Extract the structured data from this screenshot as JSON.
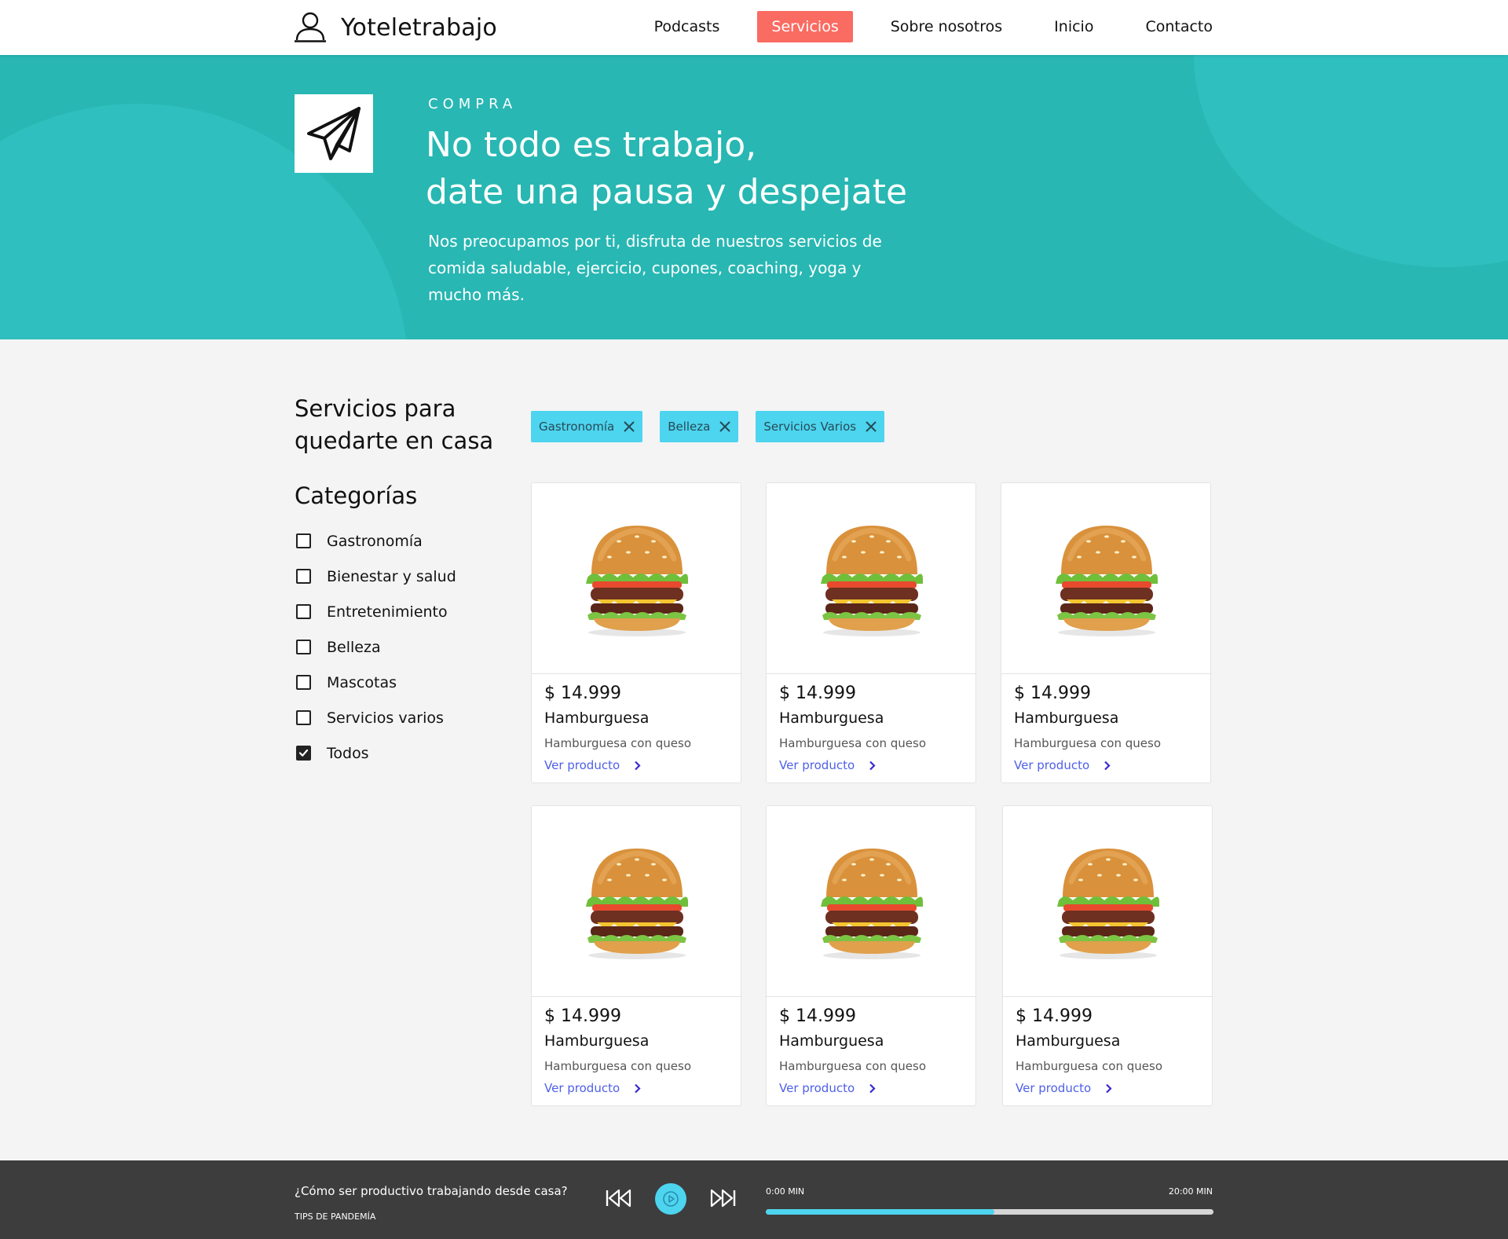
{
  "header": {
    "brand": "Yoteletrabajo",
    "brand_icon": "user-icon",
    "nav": [
      "Podcasts",
      "Servicios",
      "Sobre nosotros",
      "Inicio",
      "Contacto"
    ],
    "active_nav": "Servicios",
    "active_color": "#fa6b61"
  },
  "hero": {
    "icon": "paper-plane-icon",
    "eyebrow": "COMPRA",
    "title_line1": "No todo es trabajo,",
    "title_line2": "date una pausa y despejate",
    "description": "Nos preocupamos por ti, disfruta de nuestros servicios de comida saludable, ejercicio, cupones, coaching, yoga y mucho más.",
    "background_color": "#28b7b3"
  },
  "sidebar": {
    "title_line1": "Servicios para",
    "title_line2": "quedarte en casa",
    "categories_title": "Categorías",
    "categories": [
      {
        "label": "Gastronomía",
        "checked": false
      },
      {
        "label": "Bienestar y salud",
        "checked": false
      },
      {
        "label": "Entretenimiento",
        "checked": false
      },
      {
        "label": "Belleza",
        "checked": false
      },
      {
        "label": "Mascotas",
        "checked": false
      },
      {
        "label": "Servicios varios",
        "checked": false
      },
      {
        "label": "Todos",
        "checked": true
      }
    ]
  },
  "filters": {
    "chips": [
      "Gastronomía",
      "Belleza",
      "Servicios Varios"
    ],
    "chip_color": "#4dd4ef"
  },
  "products": [
    {
      "price": "$ 14.999",
      "name": "Hamburguesa",
      "description": "Hamburguesa con queso",
      "link": "Ver producto"
    },
    {
      "price": "$ 14.999",
      "name": "Hamburguesa",
      "description": "Hamburguesa con queso",
      "link": "Ver producto"
    },
    {
      "price": "$ 14.999",
      "name": "Hamburguesa",
      "description": "Hamburguesa con queso",
      "link": "Ver producto"
    },
    {
      "price": "$ 14.999",
      "name": "Hamburguesa",
      "description": "Hamburguesa con queso",
      "link": "Ver producto"
    },
    {
      "price": "$ 14.999",
      "name": "Hamburguesa",
      "description": "Hamburguesa con queso",
      "link": "Ver producto"
    },
    {
      "price": "$ 14.999",
      "name": "Hamburguesa",
      "description": "Hamburguesa con queso",
      "link": "Ver producto"
    }
  ],
  "player": {
    "title": "¿Cómo ser productivo trabajando desde casa?",
    "subtitle": "TIPS DE PANDEMÍA",
    "start_time": "0:00 MIN",
    "end_time": "20:00 MIN",
    "progress": 0.51,
    "accent_color": "#4dd4ef"
  }
}
